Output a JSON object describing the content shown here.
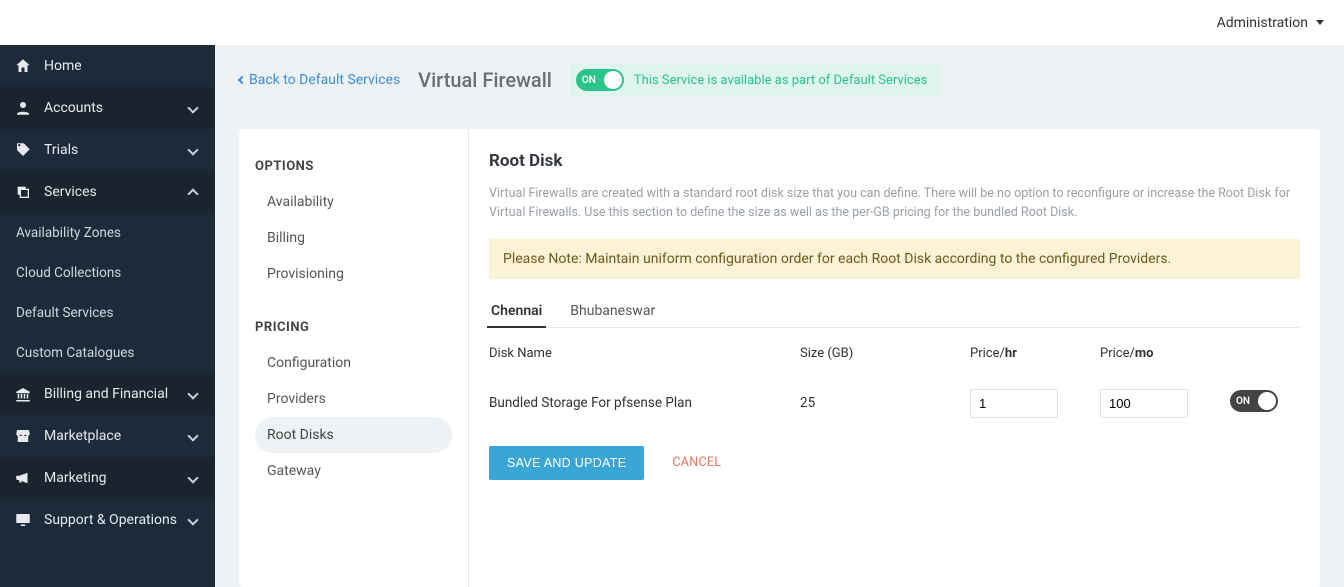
{
  "topbar": {
    "admin": "Administration"
  },
  "sidebar": {
    "home": "Home",
    "accounts": "Accounts",
    "trials": "Trials",
    "services": "Services",
    "services_sub": {
      "avail_zones": "Availability Zones",
      "cloud_collections": "Cloud Collections",
      "default_services": "Default Services",
      "custom_catalogues": "Custom Catalogues"
    },
    "billing": "Billing and Financial",
    "marketplace": "Marketplace",
    "marketing": "Marketing",
    "support": "Support & Operations"
  },
  "header": {
    "back": "Back to Default Services",
    "title": "Virtual Firewall",
    "toggle_label": "ON",
    "status_msg": "This Service is available as part of Default Services"
  },
  "card": {
    "options_heading": "OPTIONS",
    "options": {
      "availability": "Availability",
      "billing": "Billing",
      "provisioning": "Provisioning"
    },
    "pricing_heading": "PRICING",
    "pricing": {
      "configuration": "Configuration",
      "providers": "Providers",
      "root_disks": "Root Disks",
      "gateway": "Gateway"
    }
  },
  "panel": {
    "title": "Root Disk",
    "desc": "Virtual Firewalls are created with a standard root disk size that you can define. There will be no option to reconfigure or increase the Root Disk for Virtual Firewalls. Use this section to define the size as well as the per-GB pricing for the bundled Root Disk.",
    "note": "Please Note: Maintain uniform configuration order for each Root Disk according to the configured Providers.",
    "tabs": {
      "a": "Chennai",
      "b": "Bhubaneswar"
    },
    "cols": {
      "name": "Disk Name",
      "size": "Size (GB)",
      "price_pre": "Price/",
      "price_hr": "hr",
      "price_mo": "mo"
    },
    "row": {
      "name": "Bundled Storage For pfsense Plan",
      "size": "25",
      "price_hr": "1",
      "price_mo": "100",
      "toggle": "ON"
    },
    "save": "SAVE AND UPDATE",
    "cancel": "CANCEL"
  }
}
